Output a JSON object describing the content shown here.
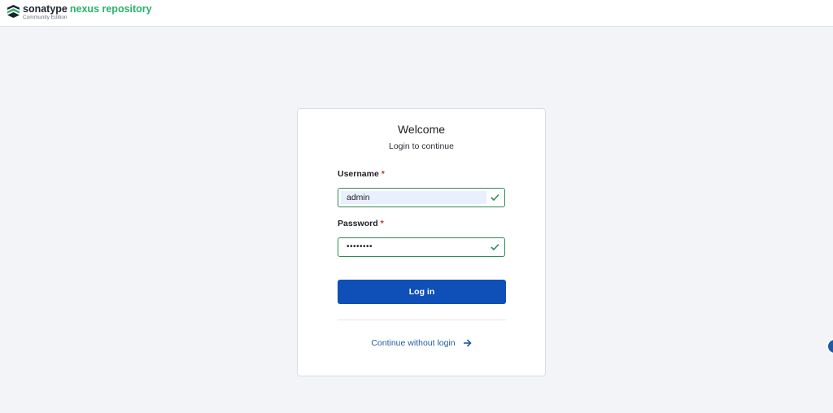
{
  "header": {
    "brand": "sonatype",
    "product": "nexus repository",
    "edition": "Community Edition"
  },
  "login": {
    "title": "Welcome",
    "subtitle": "Login to continue",
    "username_label": "Username",
    "username_value": "admin",
    "password_label": "Password",
    "password_value": "••••••••",
    "required_mark": "*",
    "login_button": "Log in",
    "continue_link": "Continue without login"
  },
  "colors": {
    "brand_green": "#27b36a",
    "primary_blue": "#0f4fb8",
    "link_blue": "#1f5aa6",
    "valid_green": "#2e8b57",
    "required_red": "#c62828"
  },
  "icons": {
    "logo": "sonatype-logo-icon",
    "valid": "check-icon",
    "continue": "arrow-right-icon"
  }
}
